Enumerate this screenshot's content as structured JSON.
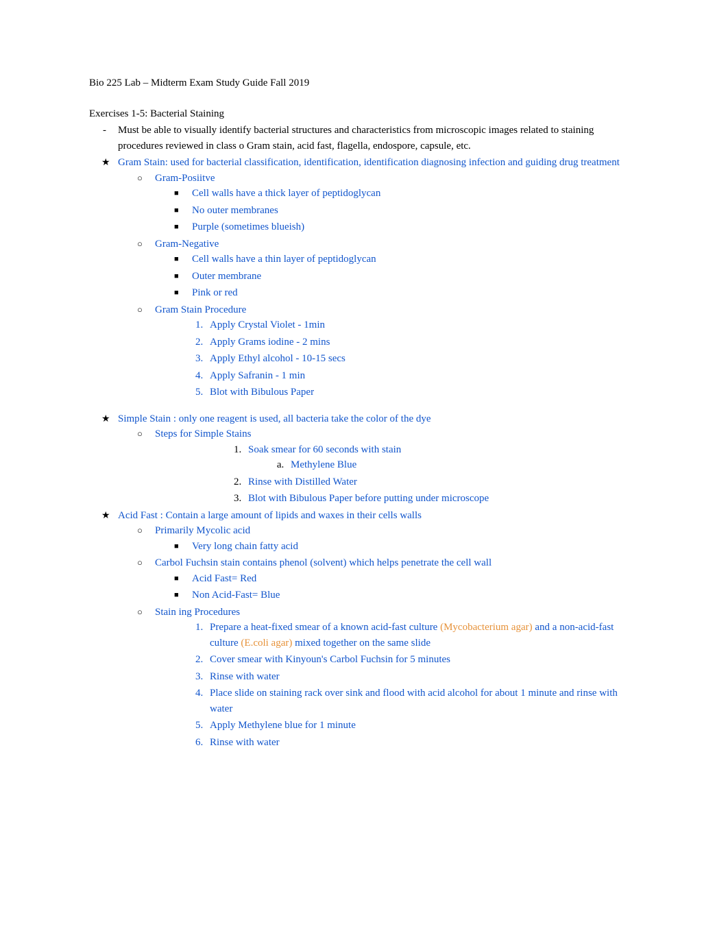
{
  "title": "Bio 225 Lab – Midterm Exam Study Guide Fall 2019",
  "section1": {
    "heading": " Exercises 1-5: Bacterial Staining",
    "dash": "Must be able to visually identify bacterial structures and characteristics from microscopic images related to staining procedures reviewed in class o Gram stain, acid fast, flagella, endospore, capsule, etc."
  },
  "gram": {
    "title_label": "Gram Stain: ",
    "title_desc": "   used for bacterial classification, identification, identification diagnosing infection and guiding drug treatment",
    "pos": {
      "label": "Gram-Posiitve",
      "b1": "Cell walls have a thick layer of peptidoglycan",
      "b2": "No outer membranes",
      "b3": "Purple (sometimes blueish)"
    },
    "neg": {
      "label": "Gram-Negative",
      "b1": "Cell walls have a thin layer of peptidoglycan",
      "b2": "Outer membrane",
      "b3": "Pink or red"
    },
    "proc": {
      "label": "Gram Stain Procedure",
      "s1": "Apply Crystal Violet - 1min",
      "s2": "Apply Grams iodine - 2 mins",
      "s3": "Apply Ethyl alcohol - 10-15 secs",
      "s4": "Apply Safranin - 1 min",
      "s5": "Blot with Bibulous Paper"
    }
  },
  "simple": {
    "title_label": "Simple Stain ",
    "title_desc": "  : only one reagent is used, all bacteria take the color of the dye",
    "steps_label": "Steps for Simple Stains",
    "s1": " Soak smear for 60 seconds with stain",
    "s1a": "Methylene Blue",
    "s2": "Rinse with Distilled Water",
    "s3": "Blot with Bibulous Paper before putting under microscope"
  },
  "acid": {
    "title_label": "Acid Fast ",
    "title_desc": " : Contain a large amount of lipids and waxes in their cells walls",
    "c1": "Primarily Mycolic acid",
    "c1b": "Very long chain fatty acid",
    "c2": "Carbol Fuchsin stain contains phenol (solvent) which helps penetrate the cell wall",
    "c2a": "Acid Fast= Red",
    "c2b": "Non   Acid-Fast= Blue",
    "c3": "Stain ing Procedures",
    "p1a": "Prepare a heat-fixed smear of a known acid-fast culture  ",
    "p1b": "(Mycobacterium agar)",
    "p1c": " and a non-acid-fast culture  ",
    "p1d": "(E.coli agar)",
    "p1e": " mixed together on the same slide",
    "p2": "Cover smear with Kinyoun's Carbol Fuchsin for 5 minutes",
    "p3": "Rinse with water",
    "p4": "Place slide on staining rack over sink and flood with acid alcohol for about 1 minute and rinse with water",
    "p5": "Apply Methylene blue for 1 minute",
    "p6": "Rinse with water"
  }
}
